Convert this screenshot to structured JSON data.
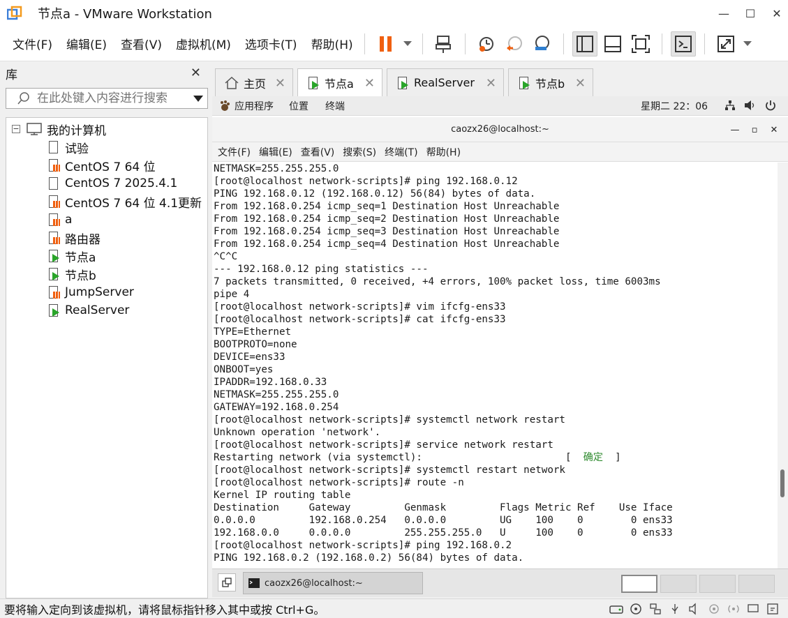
{
  "window": {
    "title": "节点a - VMware Workstation",
    "controls": {
      "minimize": "—",
      "maximize": "☐",
      "close": "✕"
    }
  },
  "menubar": {
    "items": [
      "文件(F)",
      "编辑(E)",
      "查看(V)",
      "虚拟机(M)",
      "选项卡(T)",
      "帮助(H)"
    ]
  },
  "library": {
    "title": "库",
    "search_placeholder": "在此处键入内容进行搜索",
    "root": "我的计算机",
    "items": [
      {
        "label": "试验",
        "type": "blank"
      },
      {
        "label": "CentOS 7 64 位",
        "type": "off"
      },
      {
        "label": "CentOS 7 2025.4.1",
        "type": "blank"
      },
      {
        "label": "CentOS 7 64 位 4.1更新",
        "type": "off"
      },
      {
        "label": "a",
        "type": "off"
      },
      {
        "label": "路由器",
        "type": "off"
      },
      {
        "label": "节点a",
        "type": "running"
      },
      {
        "label": "节点b",
        "type": "running"
      },
      {
        "label": "JumpServer",
        "type": "off"
      },
      {
        "label": "RealServer",
        "type": "running"
      }
    ]
  },
  "tabs": [
    {
      "label": "主页",
      "active": false
    },
    {
      "label": "节点a",
      "active": true
    },
    {
      "label": "RealServer",
      "active": false
    },
    {
      "label": "节点b",
      "active": false
    }
  ],
  "guest": {
    "topbar": {
      "apps": "应用程序",
      "places": "位置",
      "terminal": "终端",
      "clock": "星期二 22：06"
    },
    "terminal_title": "caozx26@localhost:~",
    "terminal_menu": [
      "文件(F)",
      "编辑(E)",
      "查看(V)",
      "搜索(S)",
      "终端(T)",
      "帮助(H)"
    ],
    "lines": [
      "NETMASK=255.255.255.0",
      "[root@localhost network-scripts]# ping 192.168.0.12",
      "PING 192.168.0.12 (192.168.0.12) 56(84) bytes of data.",
      "From 192.168.0.254 icmp_seq=1 Destination Host Unreachable",
      "From 192.168.0.254 icmp_seq=2 Destination Host Unreachable",
      "From 192.168.0.254 icmp_seq=3 Destination Host Unreachable",
      "From 192.168.0.254 icmp_seq=4 Destination Host Unreachable",
      "^C^C",
      "--- 192.168.0.12 ping statistics ---",
      "7 packets transmitted, 0 received, +4 errors, 100% packet loss, time 6003ms",
      "pipe 4",
      "[root@localhost network-scripts]# vim ifcfg-ens33",
      "[root@localhost network-scripts]# cat ifcfg-ens33",
      "TYPE=Ethernet",
      "BOOTPROTO=none",
      "DEVICE=ens33",
      "ONBOOT=yes",
      "IPADDR=192.168.0.33",
      "NETMASK=255.255.255.0",
      "GATEWAY=192.168.0.254",
      "[root@localhost network-scripts]# systemctl network restart",
      "Unknown operation 'network'.",
      "[root@localhost network-scripts]# service network restart",
      "Restarting network (via systemctl):                        [  ",
      "[root@localhost network-scripts]# systemctl restart network",
      "[root@localhost network-scripts]# route -n",
      "Kernel IP routing table",
      "Destination     Gateway         Genmask         Flags Metric Ref    Use Iface",
      "0.0.0.0         192.168.0.254   0.0.0.0         UG    100    0        0 ens33",
      "192.168.0.0     0.0.0.0         255.255.255.0   U     100    0        0 ens33",
      "[root@localhost network-scripts]# ping 192.168.0.2",
      "PING 192.168.0.2 (192.168.0.2) 56(84) bytes of data."
    ],
    "ok_text": "确定",
    "ok_suffix": "  ]",
    "taskbar_item": "caozx26@localhost:~"
  },
  "statusbar": {
    "message": "要将输入定向到该虚拟机，请将鼠标指针移入其中或按 Ctrl+G。"
  },
  "colors": {
    "accent_orange": "#f06010",
    "run_green": "#2aa52a",
    "ok_green": "#2d8a2d"
  }
}
